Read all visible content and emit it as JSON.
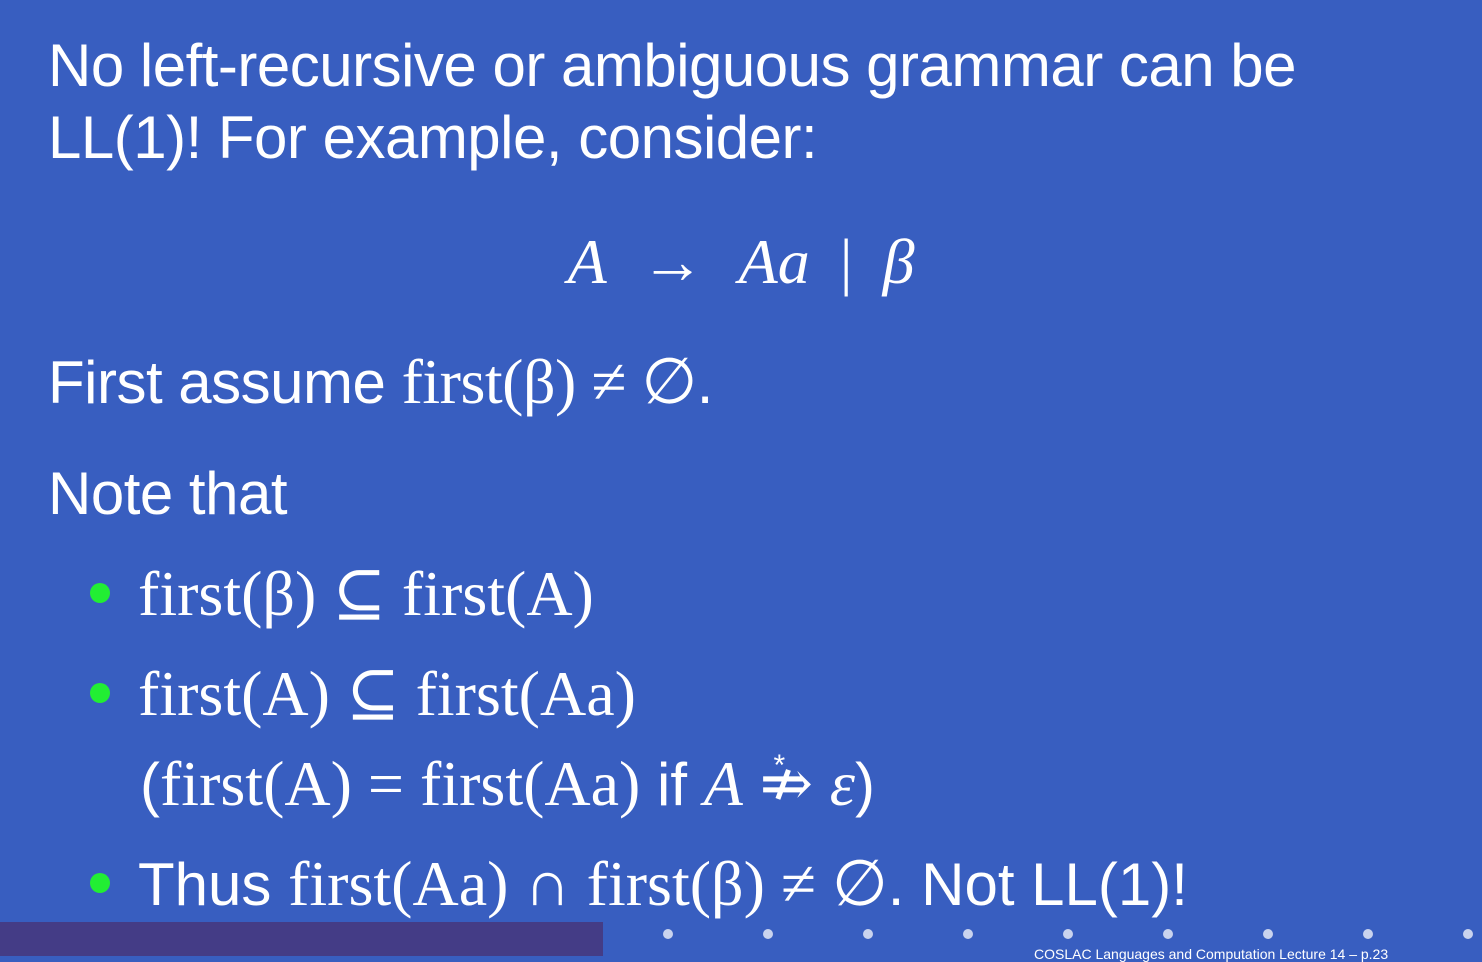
{
  "slide": {
    "heading_line1": "No left-recursive or ambiguous grammar can be",
    "heading_line2": "LL(1)!  For example, consider:",
    "production": {
      "lhs": "A",
      "arrow": "→",
      "alt1": "Aa",
      "bar": "|",
      "alt2": "β"
    },
    "assume": {
      "prefix": "First assume ",
      "math": "first(β) ≠ ∅",
      "suffix": "."
    },
    "note": "Note that",
    "bullets": [
      {
        "math": "first(β) ⊆ first(A)"
      },
      {
        "math": "first(A) ⊆ first(Aa)"
      },
      {
        "prefix": "Thus ",
        "math": "first(Aa) ∩ first(β) ≠ ∅",
        "suffix": ". Not LL(1)!"
      }
    ],
    "paren_note": {
      "open": "(",
      "math1": "first(A) = first(Aa)",
      "if": " if ",
      "lhs": "A",
      "arrow": "⇏",
      "star": "*",
      "eps": "ε",
      "close": ")"
    }
  },
  "footer": {
    "text": "COSLAC Languages and Computation Lecture 14 – p.23"
  },
  "colors": {
    "background": "#385ec0",
    "footer_bar": "#443c86",
    "bullet": "#22ee33",
    "text": "#ffffff"
  }
}
